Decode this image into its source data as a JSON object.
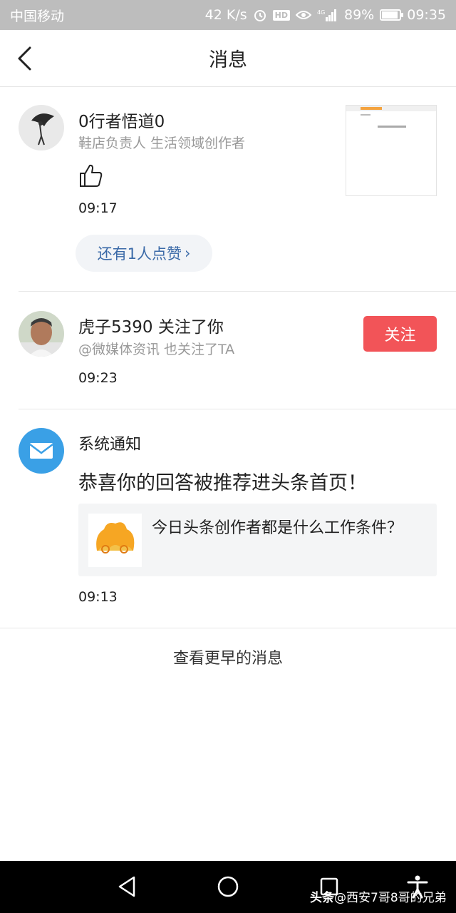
{
  "status_bar": {
    "carrier": "中国移动",
    "speed": "42 K/s",
    "hd": "HD",
    "network": "4G",
    "battery": "89%",
    "battery_level": 0.89,
    "time": "09:35"
  },
  "header": {
    "title": "消息"
  },
  "messages": [
    {
      "type": "like",
      "name": "0行者悟道0",
      "subtitle": "鞋店负责人 生活领域创作者",
      "icon": "thumbs-up-icon",
      "time": "09:17",
      "more_button": "还有1人点赞",
      "more_arrow": "›"
    },
    {
      "type": "follow",
      "name": "虎子5390 关注了你",
      "subtitle": "@微媒体资讯 也关注了TA",
      "time": "09:23",
      "follow_button": "关注"
    },
    {
      "type": "system",
      "name": "系统通知",
      "title": "恭喜你的回答被推荐进头条首页！",
      "card_text": "今日头条创作者都是什么工作条件？",
      "time": "09:13"
    }
  ],
  "footer": {
    "view_earlier": "查看更早的消息"
  },
  "watermark": {
    "brand": "头条",
    "handle": "@西安7哥8哥的兄弟"
  },
  "colors": {
    "accent_red": "#f25458",
    "link_blue": "#3b6aa8",
    "mail_blue": "#3aa0e6"
  }
}
